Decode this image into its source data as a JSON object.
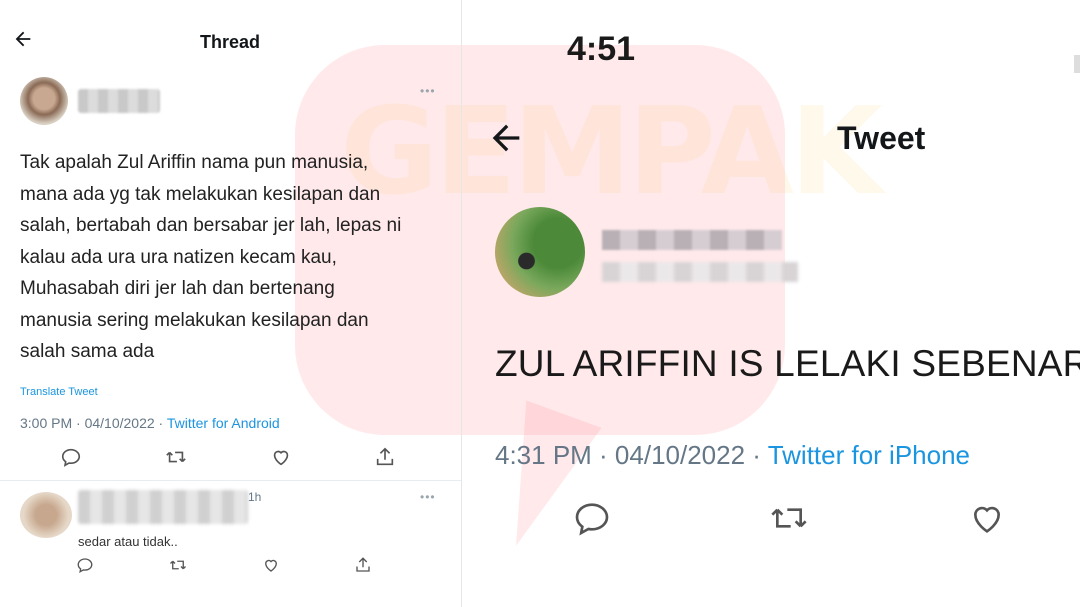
{
  "left": {
    "header": {
      "title": "Thread"
    },
    "tweet": {
      "body": "Tak apalah Zul Ariffin nama pun manusia,\nmana ada yg tak melakukan kesilapan dan\nsalah, bertabah dan bersabar jer lah, lepas ni\nkalau ada ura ura natizen kecam kau,\nMuhasabah diri jer lah dan bertenang\nmanusia sering melakukan kesilapan dan\nsalah sama ada",
      "translate_label": "Translate Tweet",
      "timestamp": "3:00 PM · 04/10/2022 · ",
      "source": "Twitter for Android"
    },
    "reply": {
      "time": "1h",
      "text": "sedar atau tidak.."
    }
  },
  "right": {
    "status_time": "4:51",
    "header": {
      "title": "Tweet"
    },
    "tweet": {
      "body": "ZUL ARIFFIN IS LELAKI SEBENAR",
      "timestamp": "4:31 PM · 04/10/2022 · ",
      "source": "Twitter for iPhone"
    }
  },
  "watermark": {
    "text": "GEMPAK",
    "color": "#ff7882"
  },
  "colors": {
    "link": "#1b95e0",
    "meta": "#657786",
    "text": "#14171a"
  },
  "icons": [
    "back-arrow-icon",
    "more-dots-icon",
    "reply-icon",
    "retweet-icon",
    "like-icon",
    "share-icon"
  ]
}
